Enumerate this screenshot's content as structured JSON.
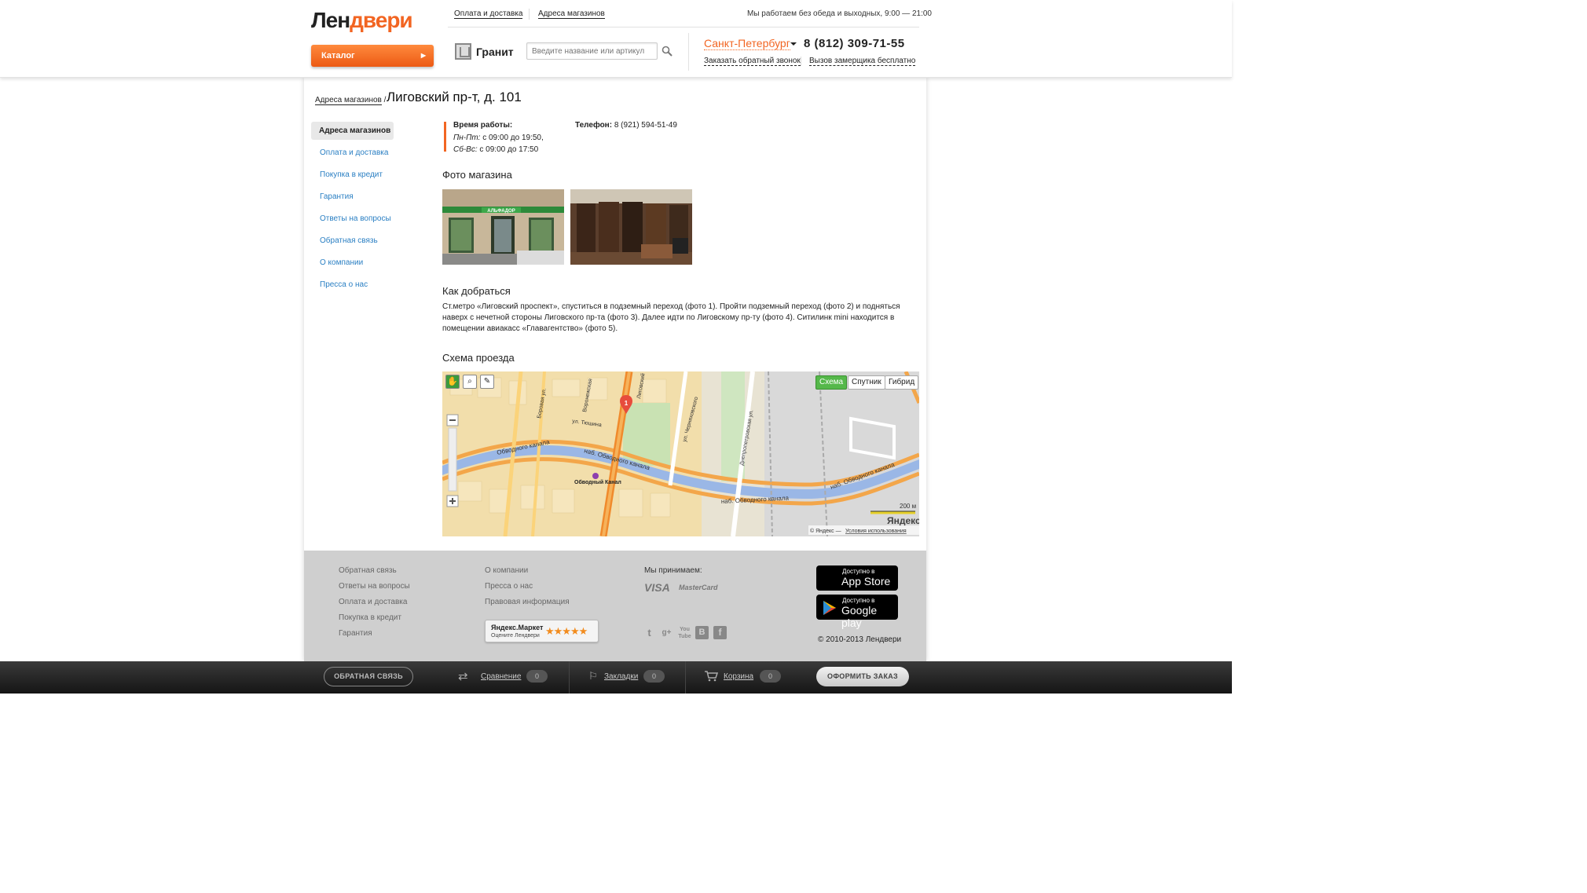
{
  "header": {
    "logo_part1": "Лен",
    "logo_part2": "двери",
    "catalog_label": "Каталог",
    "top_links": [
      "Оплата и доставка",
      "Адреса магазинов"
    ],
    "hours": "Мы работаем без обеда и выходных, 9:00 — 21:00",
    "brand": "Гранит",
    "search_placeholder": "Введите название или артикул",
    "city": "Санкт-Петербург",
    "phone": "8 (812) 309-71-55",
    "callback_link": "Заказать обратный звонок",
    "measurer_link": "Вызов замерщика бесплатно"
  },
  "breadcrumb": {
    "parent": "Адреса магазинов",
    "separator": "/",
    "title": "Лиговский пр-т, д. 101"
  },
  "sidebar": {
    "active": "Адреса магазинов",
    "items": [
      "Оплата и доставка",
      "Покупка в кредит",
      "Гарантия",
      "Ответы на вопросы",
      "Обратная связь",
      "О компании",
      "Пресса о нас"
    ]
  },
  "store": {
    "hours_label": "Время работы:",
    "weekdays_label": "Пн-Пт:",
    "weekdays_value": " с 09:00 до 19:50,",
    "weekend_label": "Сб-Вс:",
    "weekend_value": " с 09:00 до 17:50",
    "phone_label": "Телефон:",
    "phone_value": " 8 (921) 594-51-49",
    "photos_heading": "Фото магазина",
    "photo_sign": "АЛЬФАДОР",
    "howto_heading": "Как добраться",
    "howto_text": "Ст.метро «Лиговский проспект», спуститься в подземный переход (фото 1). Пройти подземный переход (фото 2) и подняться наверх с нечетной стороны Лиговского пр-та (фото 3). Далее идти по Лиговскому пр-ту (фото 4). Ситилинк mini находится в помещении авиакасс «Главагентство» (фото 5).",
    "map_heading": "Схема проезда"
  },
  "map": {
    "buttons": [
      "Схема",
      "Спутник",
      "Гибрид"
    ],
    "marker": "1",
    "labels": {
      "canal1": "наб. Обводного канала",
      "canal2": "Обводного канала",
      "canal3": "наб. Обводного канала",
      "canal4": "наб. Обводного канала",
      "metro": "Обводный Канал",
      "street1": "Боровая ул.",
      "street2": "Воронежская",
      "street3": "ул. Черняховского",
      "street4": "Днепропетровская ул.",
      "street5": "ул. Тюшина",
      "street6": "Лиговский",
      "scale": "200 м",
      "brand": "Яндекс",
      "copyright": "© Яндекс —",
      "terms": "Условия использования"
    }
  },
  "footer": {
    "col1": [
      "Обратная связь",
      "Ответы на вопросы",
      "Оплата и доставка",
      "Покупка в кредит",
      "Гарантия"
    ],
    "col2": [
      "О компании",
      "Пресса о нас",
      "Правовая информация"
    ],
    "accept": "Мы принимаем:",
    "visa": "VISA",
    "mastercard": "MasterCard",
    "ym_title": "Яндекс.Маркет",
    "ym_sub": "Оцените Лендвери",
    "ym_stars": "★★★★★",
    "appstore_small": "Доступно в",
    "appstore_big": "App Store",
    "gplay_small": "Доступно в",
    "gplay_big": "Google play",
    "copyright": "© 2010-2013 Лендвери"
  },
  "bottombar": {
    "feedback": "ОБРАТНАЯ СВЯЗЬ",
    "compare": "Сравнение",
    "compare_count": "0",
    "bookmarks": "Закладки",
    "bookmarks_count": "0",
    "cart": "Корзина",
    "cart_count": "0",
    "order": "ОФОРМИТЬ ЗАКАЗ"
  }
}
